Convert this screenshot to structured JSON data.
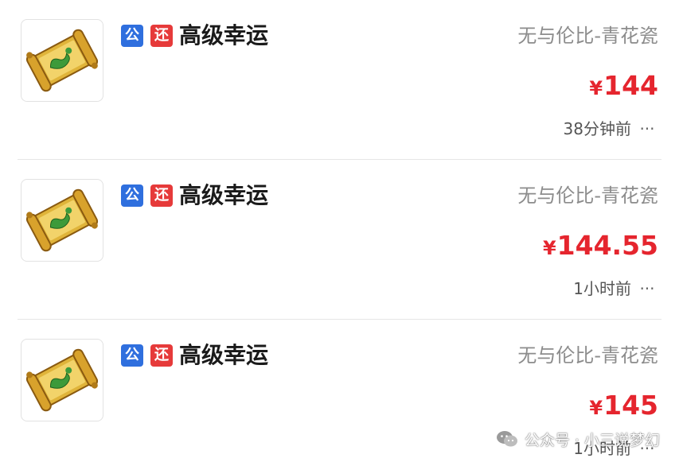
{
  "colors": {
    "public_badge": "#2f6fde",
    "return_badge": "#e63a3a",
    "price": "#e5252e",
    "server_text": "#8c8c8c",
    "title_text": "#1a1a1a"
  },
  "listings": [
    {
      "icon": "scroll-icon",
      "badge_public": "公",
      "badge_return": "还",
      "title": "高级幸运",
      "server": "无与伦比-青花瓷",
      "currency": "¥",
      "price": "144",
      "time": "38分钟前",
      "more": "···"
    },
    {
      "icon": "scroll-icon",
      "badge_public": "公",
      "badge_return": "还",
      "title": "高级幸运",
      "server": "无与伦比-青花瓷",
      "currency": "¥",
      "price": "144.55",
      "time": "1小时前",
      "more": "···"
    },
    {
      "icon": "scroll-icon",
      "badge_public": "公",
      "badge_return": "还",
      "title": "高级幸运",
      "server": "无与伦比-青花瓷",
      "currency": "¥",
      "price": "145",
      "time": "1小时前",
      "more": "···"
    }
  ],
  "watermark": {
    "icon": "wechat-icon",
    "text": "公众号 · 小三说梦幻"
  }
}
